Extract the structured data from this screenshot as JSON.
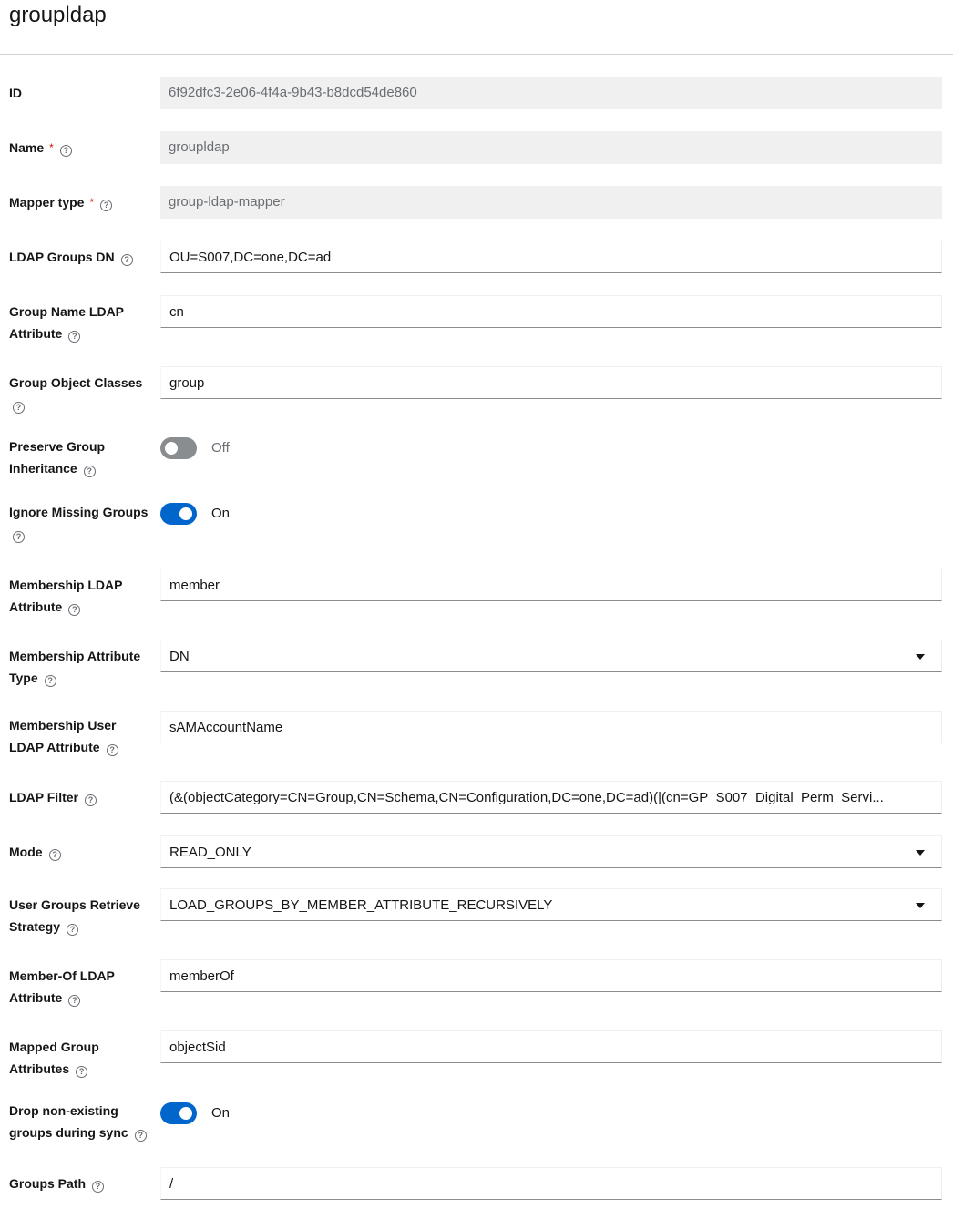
{
  "page": {
    "title": "groupldap"
  },
  "fields": {
    "id": {
      "label": "ID",
      "value": "6f92dfc3-2e06-4f4a-9b43-b8dcd54de860"
    },
    "name": {
      "label": "Name",
      "required": "*",
      "value": "groupldap"
    },
    "mapper_type": {
      "label": "Mapper type",
      "required": "*",
      "value": "group-ldap-mapper"
    },
    "ldap_groups_dn": {
      "label": "LDAP Groups DN",
      "value": "OU=S007,DC=one,DC=ad"
    },
    "group_name_ldap_attribute": {
      "label_line1": "Group Name LDAP",
      "label_line2": "Attribute",
      "value": "cn"
    },
    "group_object_classes": {
      "label": "Group Object Classes",
      "value": "group"
    },
    "preserve_group_inheritance": {
      "label_line1": "Preserve Group",
      "label_line2": "Inheritance",
      "state": "Off"
    },
    "ignore_missing_groups": {
      "label": "Ignore Missing Groups",
      "state": "On"
    },
    "membership_ldap_attribute": {
      "label_line1": "Membership LDAP",
      "label_line2": "Attribute",
      "value": "member"
    },
    "membership_attribute_type": {
      "label_line1": "Membership Attribute",
      "label_line2": "Type",
      "value": "DN"
    },
    "membership_user_ldap_attribute": {
      "label_line1": "Membership User",
      "label_line2": "LDAP Attribute",
      "value": "sAMAccountName"
    },
    "ldap_filter": {
      "label": "LDAP Filter",
      "value": "(&(objectCategory=CN=Group,CN=Schema,CN=Configuration,DC=one,DC=ad)(|(cn=GP_S007_Digital_Perm_Servi..."
    },
    "mode": {
      "label": "Mode",
      "value": "READ_ONLY"
    },
    "user_groups_retrieve_strategy": {
      "label_line1": "User Groups Retrieve",
      "label_line2": "Strategy",
      "value": "LOAD_GROUPS_BY_MEMBER_ATTRIBUTE_RECURSIVELY"
    },
    "member_of_ldap_attribute": {
      "label_line1": "Member-Of LDAP",
      "label_line2": "Attribute",
      "value": "memberOf"
    },
    "mapped_group_attributes": {
      "label_line1": "Mapped Group",
      "label_line2": "Attributes",
      "value": "objectSid"
    },
    "drop_non_existing_groups": {
      "label_line1": "Drop non-existing",
      "label_line2": "groups during sync",
      "state": "On"
    },
    "groups_path": {
      "label": "Groups Path",
      "value": "/"
    }
  },
  "icons": {
    "help": "?"
  },
  "colors": {
    "accent": "#0066cc",
    "required": "#c9190b",
    "switch_off": "#8a8d90",
    "readonly_bg": "#f0f0f0"
  }
}
